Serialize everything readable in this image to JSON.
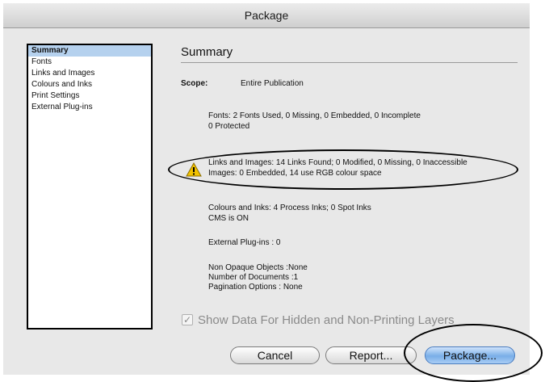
{
  "window": {
    "title": "Package"
  },
  "sidebar": {
    "items": [
      {
        "label": "Summary",
        "selected": true
      },
      {
        "label": "Fonts"
      },
      {
        "label": "Links and Images"
      },
      {
        "label": "Colours and Inks"
      },
      {
        "label": "Print Settings"
      },
      {
        "label": "External Plug-ins"
      }
    ]
  },
  "main": {
    "title": "Summary",
    "scope_label": "Scope:",
    "scope_value": "Entire Publication",
    "fonts_line1": "Fonts: 2 Fonts Used, 0 Missing, 0 Embedded, 0 Incomplete",
    "fonts_line2": "0 Protected",
    "links_line1": "Links and Images: 14 Links Found; 0 Modified, 0 Missing, 0 Inaccessible",
    "links_line2": "Images: 0 Embedded, 14 use RGB colour space",
    "colours_line1": "Colours and Inks: 4 Process Inks; 0 Spot Inks",
    "colours_line2": "CMS is ON",
    "plugins_line": "External Plug-ins : 0",
    "nonopaque_line": "Non Opaque Objects :None",
    "documents_line": "Number of Documents :1",
    "pagination_line": "Pagination Options : None",
    "warning_icon": "warning-triangle-icon"
  },
  "options": {
    "show_hidden_label": "Show Data For Hidden and Non-Printing Layers",
    "show_hidden_checked": true
  },
  "buttons": {
    "cancel": "Cancel",
    "report": "Report...",
    "package": "Package..."
  },
  "colors": {
    "selection": "#b5d1ee",
    "default_button": "#79aee8",
    "warning": "#f2c200"
  }
}
